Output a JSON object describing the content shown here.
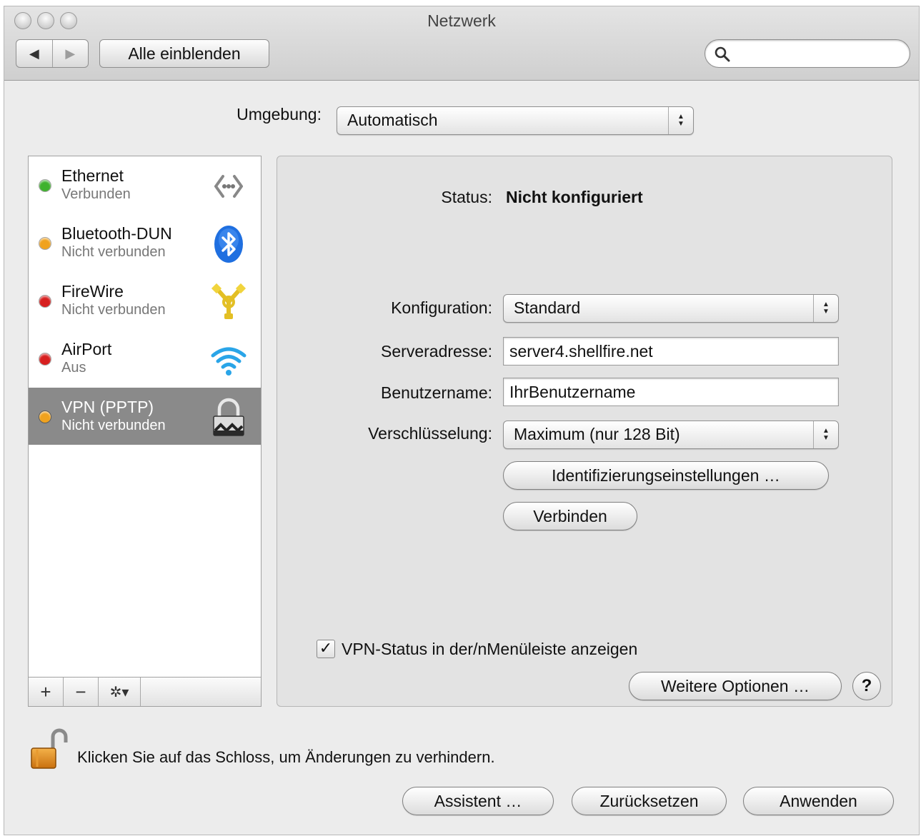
{
  "window": {
    "title": "Netzwerk"
  },
  "toolbar": {
    "back_label": "◀",
    "forward_label": "▶",
    "show_all_label": "Alle einblenden",
    "search_placeholder": ""
  },
  "location": {
    "label": "Umgebung:",
    "value": "Automatisch"
  },
  "services": [
    {
      "name": "Ethernet",
      "status": "Verbunden",
      "dot_color": "#3fb22d",
      "icon": "ethernet-icon",
      "selected": false
    },
    {
      "name": "Bluetooth-DUN",
      "status": "Nicht verbunden",
      "dot_color": "#f0a21e",
      "icon": "bluetooth-icon",
      "selected": false
    },
    {
      "name": "FireWire",
      "status": "Nicht verbunden",
      "dot_color": "#d71f1f",
      "icon": "firewire-icon",
      "selected": false
    },
    {
      "name": "AirPort",
      "status": "Aus",
      "dot_color": "#d71f1f",
      "icon": "wifi-icon",
      "selected": false
    },
    {
      "name": "VPN (PPTP)",
      "status": "Nicht verbunden",
      "dot_color": "#f0a21e",
      "icon": "vpn-lock-icon",
      "selected": true
    }
  ],
  "list_buttons": {
    "add": "+",
    "remove": "−",
    "action": "✲▾"
  },
  "detail": {
    "status_label": "Status:",
    "status_value": "Nicht konfiguriert",
    "config_label": "Konfiguration:",
    "config_value": "Standard",
    "server_label": "Serveradresse:",
    "server_value": "server4.shellfire.net",
    "user_label": "Benutzername:",
    "user_value": "IhrBenutzername",
    "encryption_label": "Verschlüsselung:",
    "encryption_value": "Maximum (nur 128 Bit)",
    "auth_button": "Identifizierungseinstellungen …",
    "connect_button": "Verbinden",
    "menubar_checkbox_label": "VPN-Status in der/nMenüleiste anzeigen",
    "menubar_checkbox_checked": true,
    "more_options_button": "Weitere Optionen …",
    "help_label": "?"
  },
  "footer": {
    "lock_text": "Klicken Sie auf das Schloss, um Änderungen zu verhindern.",
    "assistant_button": "Assistent …",
    "revert_button": "Zurücksetzen",
    "apply_button": "Anwenden"
  }
}
